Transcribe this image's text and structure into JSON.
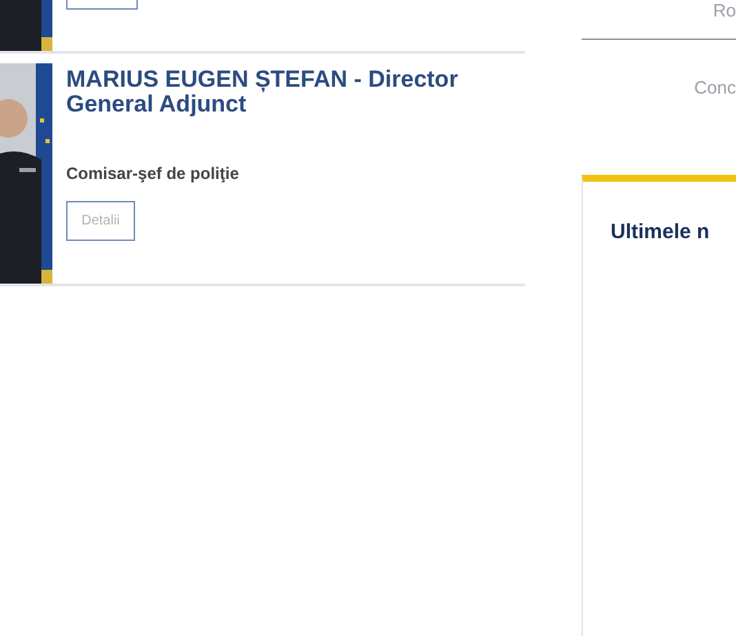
{
  "officials": [
    {
      "button": {
        "cut_off": true
      }
    },
    {
      "name": "MARIUS EUGEN ȘTEFAN - Director General Adjunct",
      "rank": "Comisar-şef de poliţie",
      "button": {
        "label": "Detalii"
      }
    }
  ],
  "sidebar": {
    "links": [
      "Ro",
      "Conc"
    ],
    "news_panel": {
      "title": "Ultimele n"
    }
  }
}
